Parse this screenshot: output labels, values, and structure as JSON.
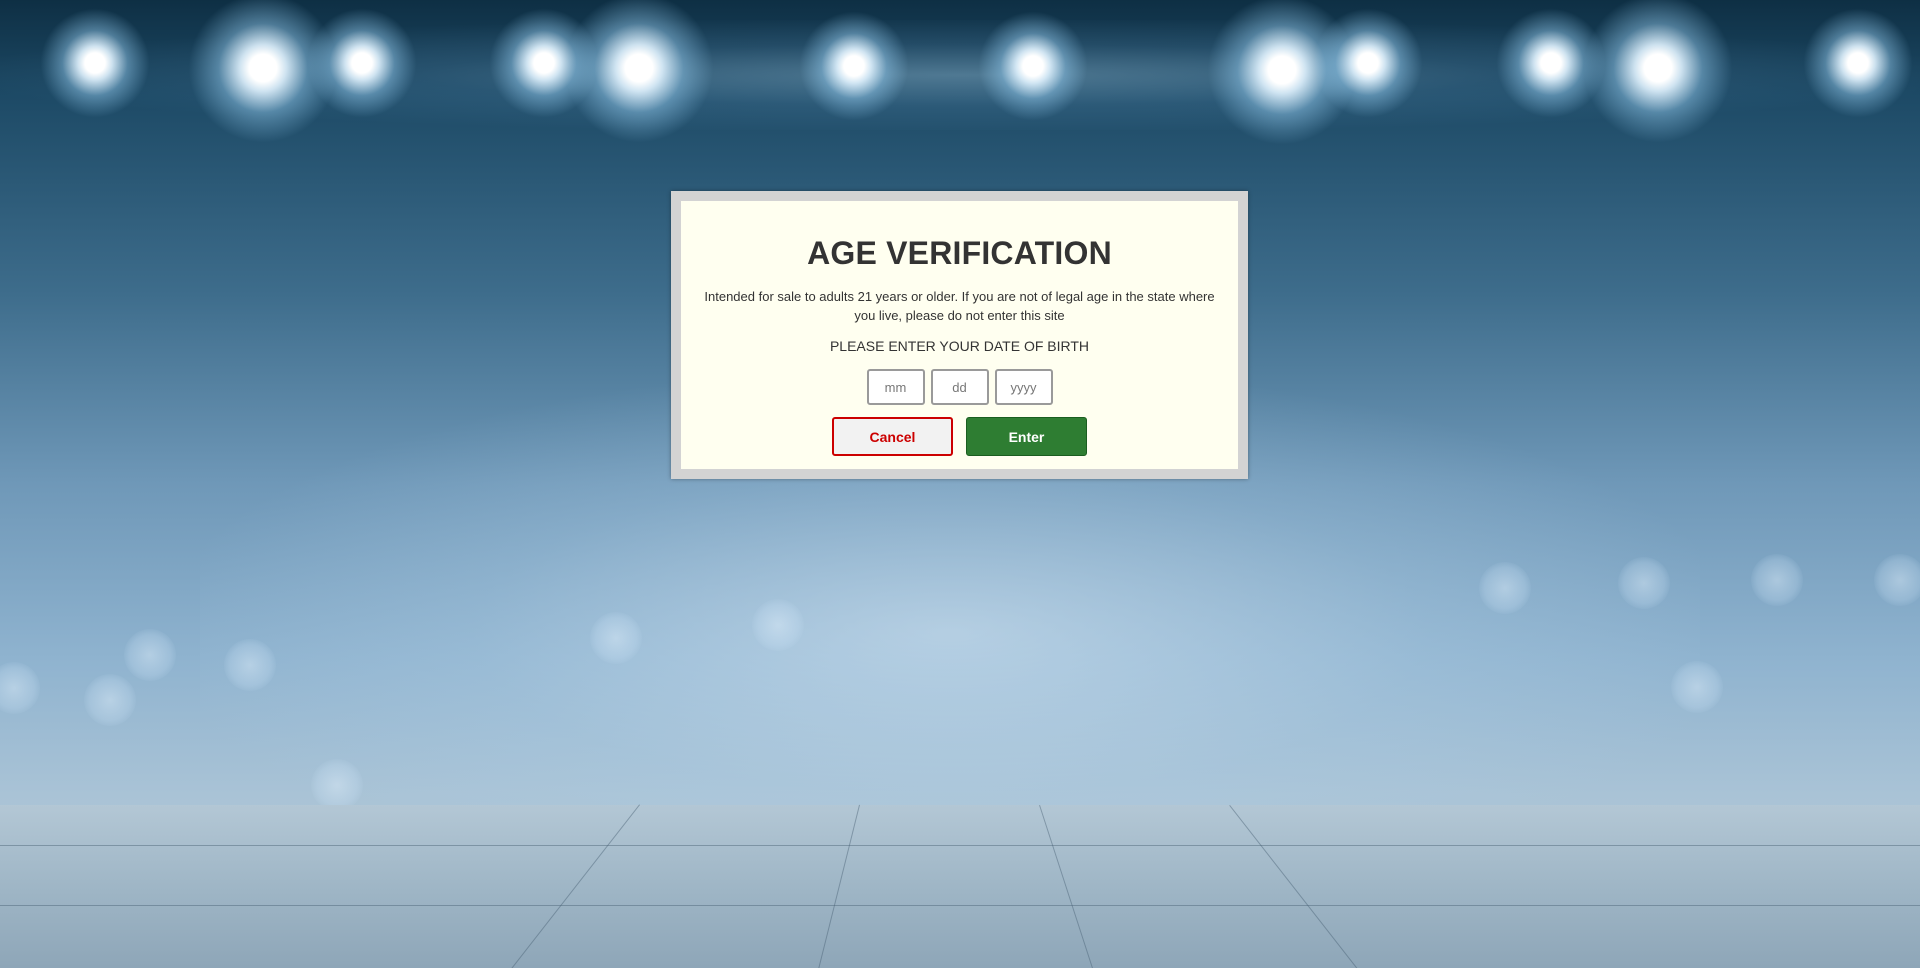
{
  "modal": {
    "title": "AGE VERIFICATION",
    "description": "Intended for sale to adults 21 years or older. If you are not of legal age in the state where you live, please do not enter this site",
    "dob_prompt": "PLEASE ENTER YOUR DATE OF BIRTH",
    "inputs": {
      "month": {
        "placeholder": "mm",
        "value": ""
      },
      "day": {
        "placeholder": "dd",
        "value": ""
      },
      "year": {
        "placeholder": "yyyy",
        "value": ""
      }
    },
    "buttons": {
      "cancel": "Cancel",
      "enter": "Enter"
    }
  },
  "colors": {
    "modal_background": "#fffff0",
    "modal_frame": "#d3d3d3",
    "cancel_accent": "#cc0000",
    "enter_accent": "#2e7d32",
    "text": "#333333"
  }
}
